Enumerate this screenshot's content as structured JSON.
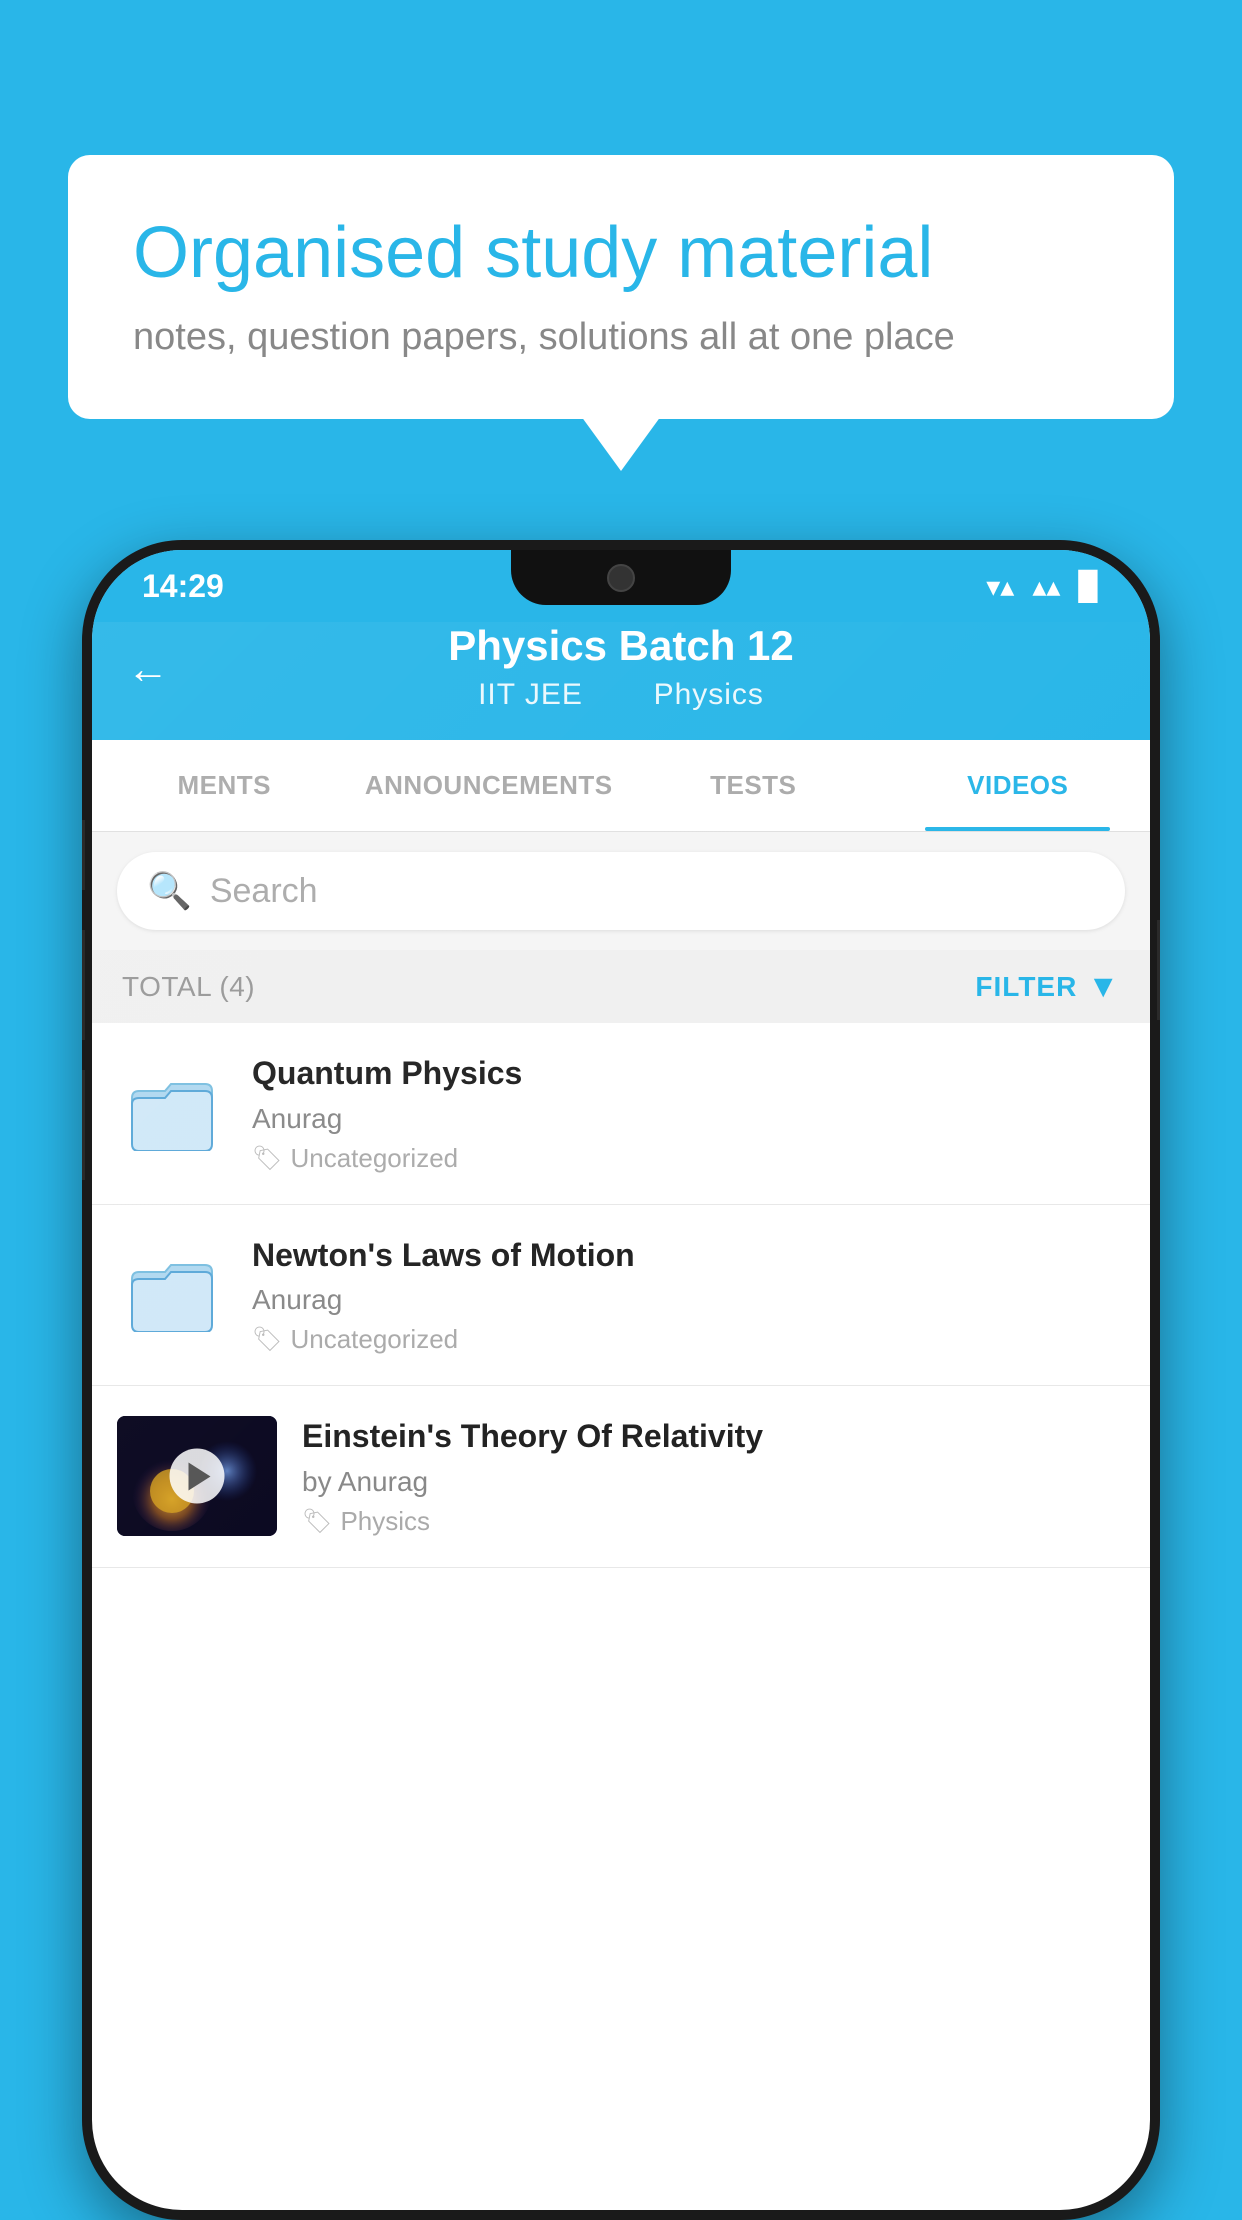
{
  "background_color": "#29b6e8",
  "speech_bubble": {
    "title": "Organised study material",
    "subtitle": "notes, question papers, solutions all at one place"
  },
  "status_bar": {
    "time": "14:29",
    "wifi": "▲",
    "signal": "▲",
    "battery": "▉"
  },
  "header": {
    "title": "Physics Batch 12",
    "tag1": "IIT JEE",
    "tag2": "Physics",
    "back_label": "←"
  },
  "tabs": [
    {
      "label": "MENTS",
      "active": false
    },
    {
      "label": "ANNOUNCEMENTS",
      "active": false
    },
    {
      "label": "TESTS",
      "active": false
    },
    {
      "label": "VIDEOS",
      "active": true
    }
  ],
  "search": {
    "placeholder": "Search"
  },
  "filter_bar": {
    "total_label": "TOTAL (4)",
    "filter_label": "FILTER"
  },
  "videos": [
    {
      "title": "Quantum Physics",
      "author": "Anurag",
      "tag": "Uncategorized",
      "has_thumb": false
    },
    {
      "title": "Newton's Laws of Motion",
      "author": "Anurag",
      "tag": "Uncategorized",
      "has_thumb": false
    },
    {
      "title": "Einstein's Theory Of Relativity",
      "author": "by Anurag",
      "tag": "Physics",
      "has_thumb": true
    }
  ]
}
